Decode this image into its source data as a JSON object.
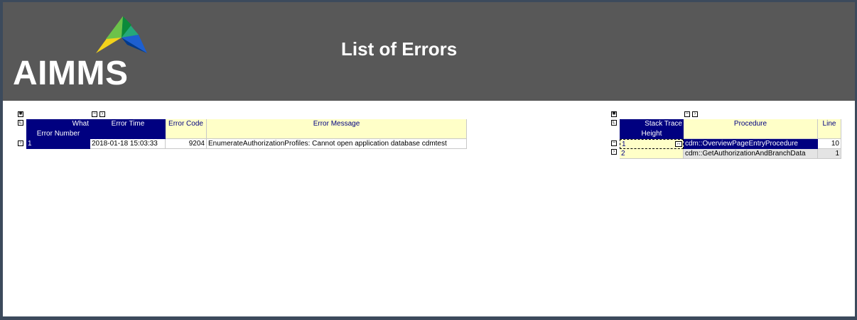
{
  "app": {
    "logo_text": "AIMMS",
    "page_title": "List of Errors"
  },
  "errors_table": {
    "row_header_label": "Error Number",
    "corner_label": "What",
    "columns": [
      "Error Time",
      "Error Code",
      "Error Message"
    ],
    "rows": [
      {
        "number": "1",
        "time": "2018-01-18 15:03:33",
        "code": "9204",
        "message": "EnumerateAuthorizationProfiles: Cannot open application database cdmtest"
      }
    ]
  },
  "stack_table": {
    "row_header_label": "Height",
    "corner_label": "Stack Trace",
    "columns": [
      "Procedure",
      "Line"
    ],
    "rows": [
      {
        "height": "1",
        "procedure": "cdm::OverviewPageEntryProcedure",
        "line": "10"
      },
      {
        "height": "2",
        "procedure": "cdm::GetAuthorizationAndBranchData",
        "line": "1"
      }
    ]
  },
  "colors": {
    "header_bg": "#585858",
    "selection": "#000080",
    "header_cell": "#ffffc8",
    "frame": "#3c4a5c"
  }
}
